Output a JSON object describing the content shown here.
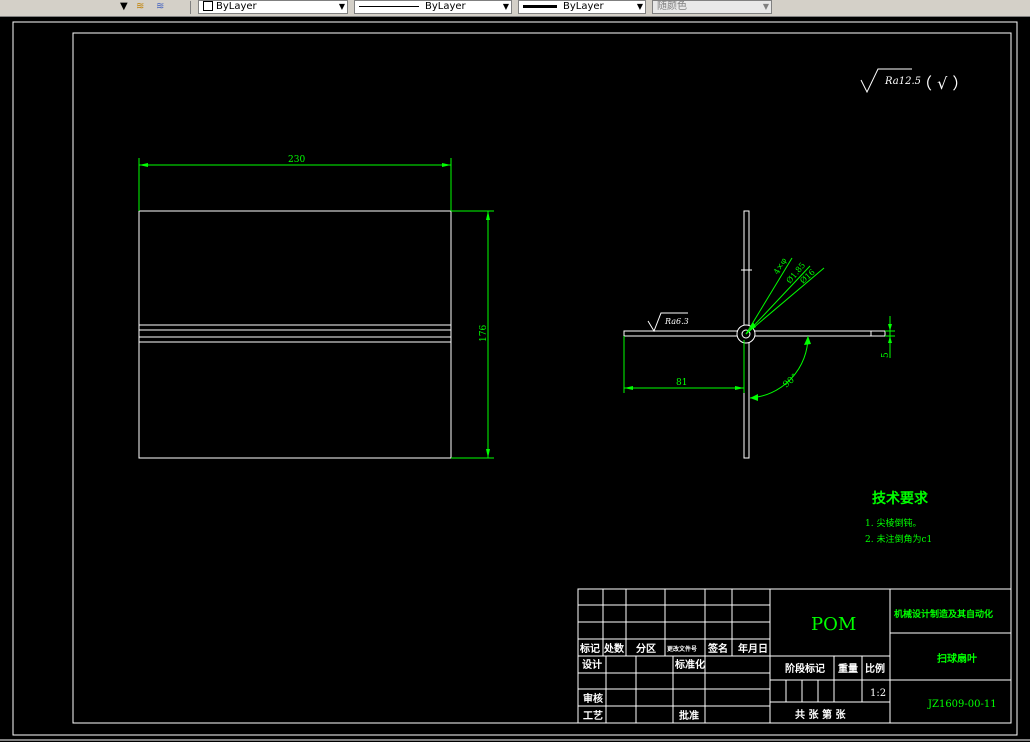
{
  "toolbar": {
    "layer_color": "ByLayer",
    "linetype": "ByLayer",
    "lineweight": "ByLayer",
    "plot_style": "随颜色"
  },
  "drawing": {
    "roughness_top": "Ra12.5",
    "roughness_top_paren": "（ √ ）",
    "roughness_side": "Ra6.3",
    "dim_width": "230",
    "dim_height": "176",
    "dim_81": "81",
    "dim_5": "5",
    "dim_angle": "90°",
    "dim_diam_small": "4×φ",
    "dim_diam_mid": "Ø1.85",
    "dim_diam_large": "Ø16",
    "tech_title": "技术要求",
    "tech_req_1": "1. 尖棱倒钝。",
    "tech_req_2": "2. 未注倒角为c1"
  },
  "title_block": {
    "material": "POM",
    "company": "机械设计制造及其自动化",
    "part_name": "扫球扇叶",
    "drawing_no": "JZ1609-00-11",
    "scale": "1:2",
    "h_mark": "标记",
    "h_count": "处数",
    "h_zone": "分区",
    "h_docno": "更改文件号",
    "h_sign": "签名",
    "h_date": "年月日",
    "r_design": "设计",
    "r_standard": "标准化",
    "r_stage": "阶段标记",
    "r_weight": "重量",
    "r_scale": "比例",
    "r_review": "审核",
    "r_process": "工艺",
    "r_approve": "批准",
    "r_sheets": "共 张 第 张"
  }
}
